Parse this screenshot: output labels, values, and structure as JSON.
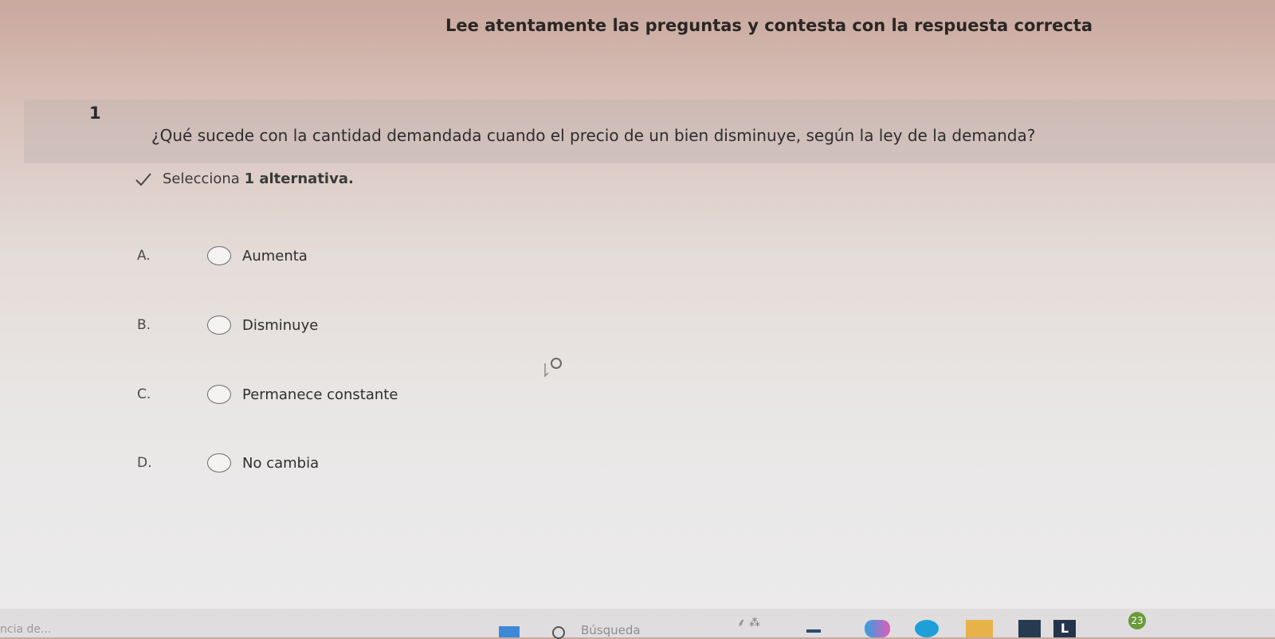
{
  "header": {
    "title": "Lee atentamente las preguntas y contesta con la respuesta correcta"
  },
  "question": {
    "number": "1",
    "text": "¿Qué sucede con la cantidad demandada cuando el precio de un bien disminuye, según la ley de la demanda?",
    "instruction_prefix": "Selecciona",
    "instruction_bold": "1 alternativa."
  },
  "options": [
    {
      "letter": "A.",
      "label": "Aumenta"
    },
    {
      "letter": "B.",
      "label": "Disminuye"
    },
    {
      "letter": "C.",
      "label": "Permanece constante"
    },
    {
      "letter": "D.",
      "label": "No cambia"
    }
  ],
  "taskbar": {
    "left_text": "ncia de...",
    "search_placeholder": "Búsqueda",
    "badge_count": "23",
    "app_letter": "L"
  },
  "colors": {
    "radio_border": "#6c6c6c",
    "start_blue": "#3e88d8",
    "edge_blue": "#1f9fd8",
    "folder_yellow": "#e8b24a"
  }
}
